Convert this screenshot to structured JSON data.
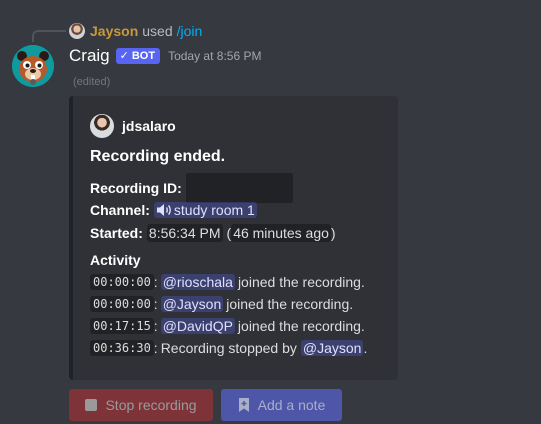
{
  "interaction": {
    "user": "Jayson",
    "used_text": "used",
    "command": "/join"
  },
  "message": {
    "author": "Craig",
    "bot_tag": "BOT",
    "bot_check": "✓",
    "timestamp": "Today at 8:56 PM",
    "edited": "(edited)"
  },
  "embed": {
    "author_name": "jdsalaro",
    "title": "Recording ended.",
    "fields": {
      "recording_id_label": "Recording ID:",
      "channel_label": "Channel:",
      "channel_value": "study room 1",
      "started_label": "Started:",
      "started_time": "8:56:34 PM",
      "started_relative_open": "(",
      "started_relative": "46 minutes ago",
      "started_relative_close": ")"
    },
    "activity_title": "Activity",
    "activity": [
      {
        "time": "00:00:00",
        "sep": ":",
        "mention": "@rioschala",
        "text": "joined the recording."
      },
      {
        "time": "00:00:00",
        "sep": ":",
        "mention": "@Jayson",
        "text": "joined the recording."
      },
      {
        "time": "00:17:15",
        "sep": ":",
        "mention": "@DavidQP",
        "text": "joined the recording."
      },
      {
        "time": "00:36:30",
        "sep": ":",
        "prefix": "Recording stopped by",
        "mention": "@Jayson",
        "suffix": "."
      }
    ]
  },
  "buttons": {
    "stop_label": "Stop recording",
    "note_label": "Add a note"
  },
  "icons": {
    "speaker": "speaker-icon",
    "stop": "stop-square-icon",
    "note": "bookmark-add-icon"
  },
  "colors": {
    "background": "#36393f",
    "embed": "#2f3136",
    "blurple": "#5865f2",
    "danger": "#7e3338",
    "link": "#00aff4",
    "username_gold": "#c69a3b"
  }
}
